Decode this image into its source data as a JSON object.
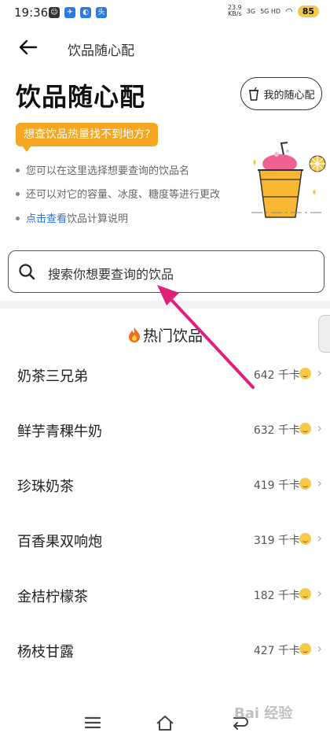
{
  "status_bar": {
    "time": "19:36",
    "net_speed": "23.9",
    "net_unit": "KB/s",
    "signal1": "3G",
    "signal2": "5G HD",
    "battery": "85"
  },
  "topbar": {
    "title": "饮品随心配"
  },
  "header": {
    "page_title": "饮品随心配",
    "my_button_label": "我的随心配"
  },
  "bubble_text": "想查饮品热量找不到地方?",
  "tips": [
    {
      "text": "您可以在这里选择想要查询的饮品名"
    },
    {
      "text": "还可以对它的容量、冰度、糖度等进行更改"
    },
    {
      "link": "点击查看",
      "text": "饮品计算说明"
    }
  ],
  "search": {
    "placeholder": "搜索你想要查询的饮品"
  },
  "section_title": "热门饮品",
  "unit": "千卡",
  "drinks": [
    {
      "name": "奶茶三兄弟",
      "kcal": "642"
    },
    {
      "name": "鲜芋青稞牛奶",
      "kcal": "632"
    },
    {
      "name": "珍珠奶茶",
      "kcal": "419"
    },
    {
      "name": "百香果双响炮",
      "kcal": "319"
    },
    {
      "name": "金桔柠檬茶",
      "kcal": "182"
    },
    {
      "name": "杨枝甘露",
      "kcal": "427"
    }
  ],
  "watermark": "Bai 经验",
  "colors": {
    "accent_orange": "#f5a623",
    "link_blue": "#2a6ee2",
    "annotation_arrow": "#e0217a"
  }
}
